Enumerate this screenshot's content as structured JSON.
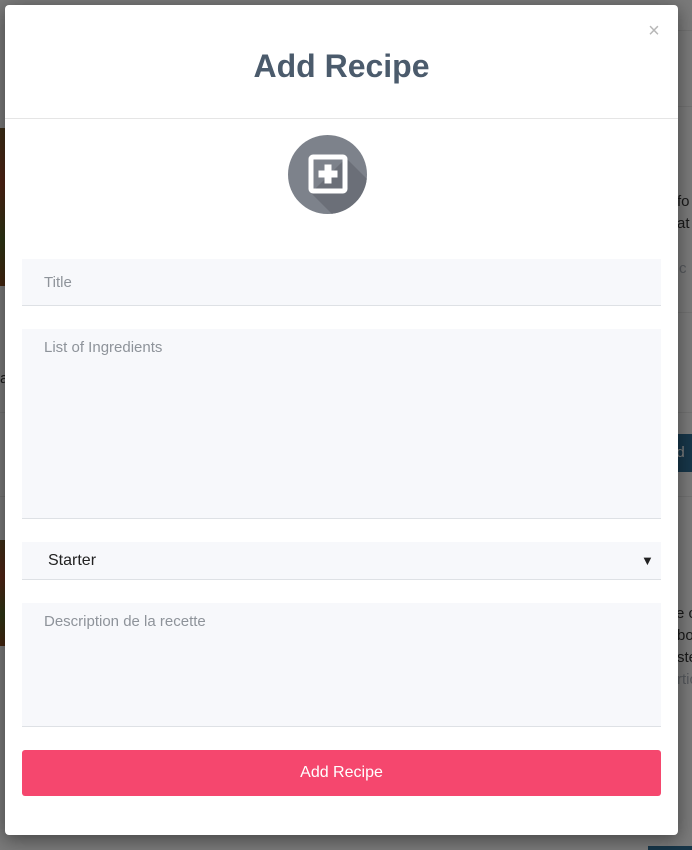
{
  "background": {
    "fragments": [
      "fo",
      "at",
      "c",
      "a",
      "dd",
      "e c",
      "bo",
      "ste",
      "rtic"
    ]
  },
  "modal": {
    "title": "Add Recipe",
    "close_label": "×",
    "image_upload_icon": "plus-square-icon",
    "form": {
      "title_placeholder": "Title",
      "ingredients_placeholder": "List of Ingredients",
      "category_selected": "Starter",
      "category_arrow": "▼",
      "description_placeholder": "Description de la recette",
      "submit_label": "Add Recipe"
    }
  },
  "colors": {
    "title": "#4b5b6c",
    "submit_button": "#f5476e",
    "field_background": "#f7f8fb",
    "icon_circle": "#7d828b",
    "background_button": "#2f6d93"
  }
}
